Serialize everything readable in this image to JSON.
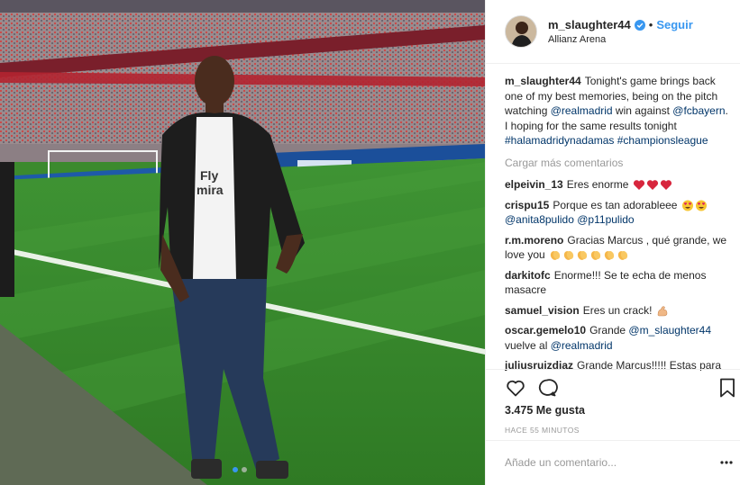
{
  "post": {
    "username": "m_slaughter44",
    "follow_label": "Seguir",
    "separator": "•",
    "location": "Allianz Arena",
    "carousel": {
      "count": 2,
      "active_index": 0
    }
  },
  "caption": {
    "username": "m_slaughter44",
    "segments": [
      {
        "text": "Tonight's game brings back one of my best memories, being on the pitch watching ",
        "mention": false
      },
      {
        "text": "@realmadrid",
        "mention": true
      },
      {
        "text": " win against ",
        "mention": false
      },
      {
        "text": "@fcbayern",
        "mention": true
      },
      {
        "text": ". I hoping for the same results tonight ",
        "mention": false
      },
      {
        "text": "#halamadridynadamas",
        "mention": true
      },
      {
        "text": " ",
        "mention": false
      },
      {
        "text": "#championsleague",
        "mention": true
      }
    ]
  },
  "load_more_label": "Cargar más comentarios",
  "comments": [
    {
      "user": "elpeivin_13",
      "segments": [
        {
          "text": "Eres enorme ",
          "mention": false
        }
      ],
      "emoji": [
        "red-heart",
        "red-heart",
        "red-heart"
      ]
    },
    {
      "user": "crispu15",
      "segments": [
        {
          "text": "Porque es tan adorableee ",
          "mention": false
        }
      ],
      "emoji": [
        "heart-eyes",
        "heart-eyes"
      ],
      "after": [
        {
          "text": "@anita8pulido",
          "mention": true
        },
        {
          "text": " ",
          "mention": false
        },
        {
          "text": "@p11pulido",
          "mention": true
        }
      ]
    },
    {
      "user": "r.m.moreno",
      "segments": [
        {
          "text": "Gracias Marcus , qué grande, we love you ",
          "mention": false
        }
      ],
      "emoji": [
        "clap",
        "clap",
        "clap",
        "clap",
        "clap",
        "clap"
      ]
    },
    {
      "user": "darkitofc",
      "segments": [
        {
          "text": "Enorme!!! Se te echa de menos masacre",
          "mention": false
        }
      ],
      "emoji": []
    },
    {
      "user": "samuel_vision",
      "segments": [
        {
          "text": "Eres un crack! ",
          "mention": false
        }
      ],
      "emoji": [
        "flexed-bicep"
      ]
    },
    {
      "user": "oscar.gemelo10",
      "segments": [
        {
          "text": "Grande ",
          "mention": false
        },
        {
          "text": "@m_slaughter44",
          "mention": true
        },
        {
          "text": " vuelve al ",
          "mention": false
        },
        {
          "text": "@realmadrid",
          "mention": true
        }
      ],
      "emoji": []
    },
    {
      "user": "juliusruizdiaz",
      "segments": [
        {
          "text": "Grande Marcus!!!!! Estas para",
          "mention": false
        }
      ],
      "emoji": []
    }
  ],
  "actions": {
    "like_icon": "heart-outline-icon",
    "comment_icon": "comment-bubble-icon",
    "save_icon": "bookmark-icon"
  },
  "likes_label": "3.475 Me gusta",
  "timestamp": "HACE 55 MINUTOS",
  "add_comment": {
    "placeholder": "Añade un comentario...",
    "value": ""
  },
  "colors": {
    "link": "#003569",
    "follow": "#3897f0",
    "muted": "#999999",
    "verified": "#3897f0"
  }
}
